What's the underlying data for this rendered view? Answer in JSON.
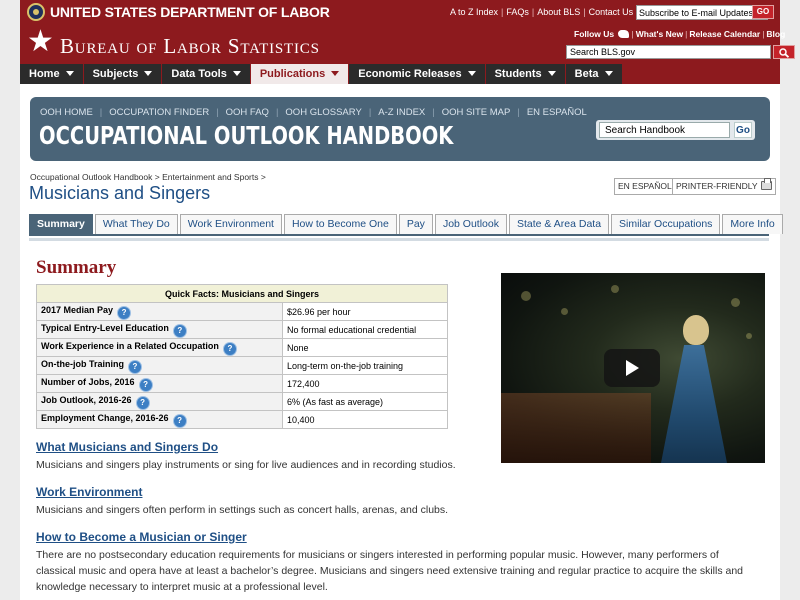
{
  "header": {
    "department": "UNITED STATES DEPARTMENT OF LABOR",
    "util_links": [
      "A to Z Index",
      "FAQs",
      "About BLS",
      "Contact Us"
    ],
    "email_placeholder": "Subscribe to E-mail Updates",
    "go_label": "GO",
    "agency": "Bureau of Labor Statistics",
    "follow_label": "Follow Us",
    "follow_links": [
      "What's New",
      "Release Calendar",
      "Blog"
    ],
    "search_placeholder": "Search BLS.gov"
  },
  "mainnav": [
    {
      "label": "Home"
    },
    {
      "label": "Subjects"
    },
    {
      "label": "Data Tools"
    },
    {
      "label": "Publications"
    },
    {
      "label": "Economic Releases"
    },
    {
      "label": "Students"
    },
    {
      "label": "Beta"
    }
  ],
  "ooh": {
    "links": [
      "OOH HOME",
      "OCCUPATION FINDER",
      "OOH FAQ",
      "OOH GLOSSARY",
      "A-Z INDEX",
      "OOH SITE MAP",
      "EN ESPAÑOL"
    ],
    "title": "OCCUPATIONAL OUTLOOK HANDBOOK",
    "search_value": "Search Handbook",
    "go_label": "Go"
  },
  "breadcrumb": {
    "crumb1": "Occupational Outlook Handbook",
    "sep": ">",
    "crumb2": "Entertainment and Sports"
  },
  "page": {
    "title": "Musicians and Singers",
    "spanish_label": "EN ESPAÑOL",
    "printer_label": "PRINTER-FRIENDLY"
  },
  "tabs": [
    "Summary",
    "What They Do",
    "Work Environment",
    "How to Become One",
    "Pay",
    "Job Outlook",
    "State & Area Data",
    "Similar Occupations",
    "More Info"
  ],
  "summary": {
    "title": "Summary",
    "table_title": "Quick Facts: Musicians and Singers",
    "rows": [
      {
        "label": "2017 Median Pay",
        "value": "$26.96 per hour"
      },
      {
        "label": "Typical Entry-Level Education",
        "value": "No formal educational credential"
      },
      {
        "label": "Work Experience in a Related Occupation",
        "value": "None"
      },
      {
        "label": "On-the-job Training",
        "value": "Long-term on-the-job training"
      },
      {
        "label": "Number of Jobs, 2016",
        "value": "172,400"
      },
      {
        "label": "Job Outlook, 2016-26",
        "value": "6% (As fast as average)"
      },
      {
        "label": "Employment Change, 2016-26",
        "value": "10,400"
      }
    ],
    "help_glyph": "?"
  },
  "sections": [
    {
      "heading": "What Musicians and Singers Do",
      "text": "Musicians and singers play instruments or sing for live audiences and in recording studios."
    },
    {
      "heading": "Work Environment",
      "text": "Musicians and singers often perform in settings such as concert halls, arenas, and clubs."
    },
    {
      "heading": "How to Become a Musician or Singer",
      "text": "There are no postsecondary education requirements for musicians or singers interested in performing popular music. However, many performers of classical music and opera have at least a bachelor’s degree. Musicians and singers need extensive training and regular practice to acquire the skills and knowledge necessary to interpret music at a professional level."
    }
  ],
  "colors": {
    "bls_red": "#8d1a1e",
    "ooh_slate": "#4a6478",
    "link_blue": "#1f4f85"
  },
  "icons": [
    "dol-seal-icon",
    "bls-star-icon",
    "twitter-icon",
    "search-icon",
    "printer-icon",
    "help-icon",
    "play-icon"
  ]
}
